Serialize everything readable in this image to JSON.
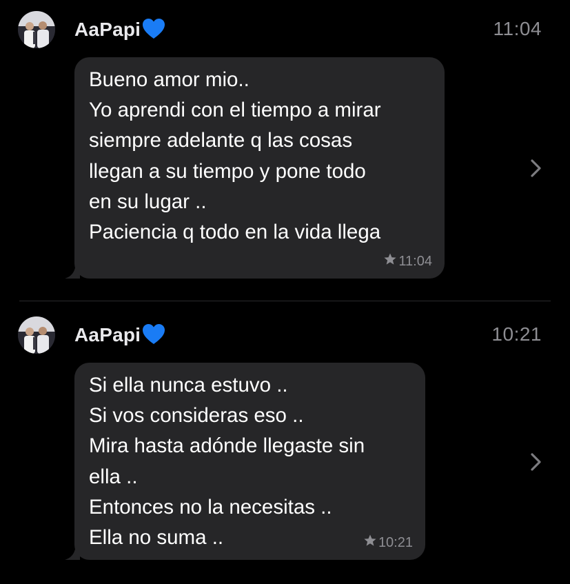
{
  "conversation": {
    "messages": [
      {
        "sender": "AaPapi",
        "sender_emoji": "blue-heart-icon",
        "time": "11:04",
        "starred": true,
        "stamp": "11:04",
        "lines": [
          "Bueno amor mio..",
          "Yo aprendi con el tiempo a mirar",
          "siempre adelante q las cosas",
          "llegan a su tiempo y pone todo",
          "en su lugar ..",
          "Paciencia q todo en la vida llega"
        ]
      },
      {
        "sender": "AaPapi",
        "sender_emoji": "blue-heart-icon",
        "time": "10:21",
        "starred": true,
        "stamp": "10:21",
        "lines": [
          "Si ella nunca estuvo ..",
          "Si vos consideras eso ..",
          "Mira hasta adónde llegaste sin",
          "ella ..",
          "Entonces no la necesitas ..",
          "Ella no suma .."
        ]
      }
    ]
  },
  "colors": {
    "background": "#000000",
    "bubble": "#262628",
    "secondary_text": "#8e8e93",
    "heart": "#1a7cf5"
  }
}
